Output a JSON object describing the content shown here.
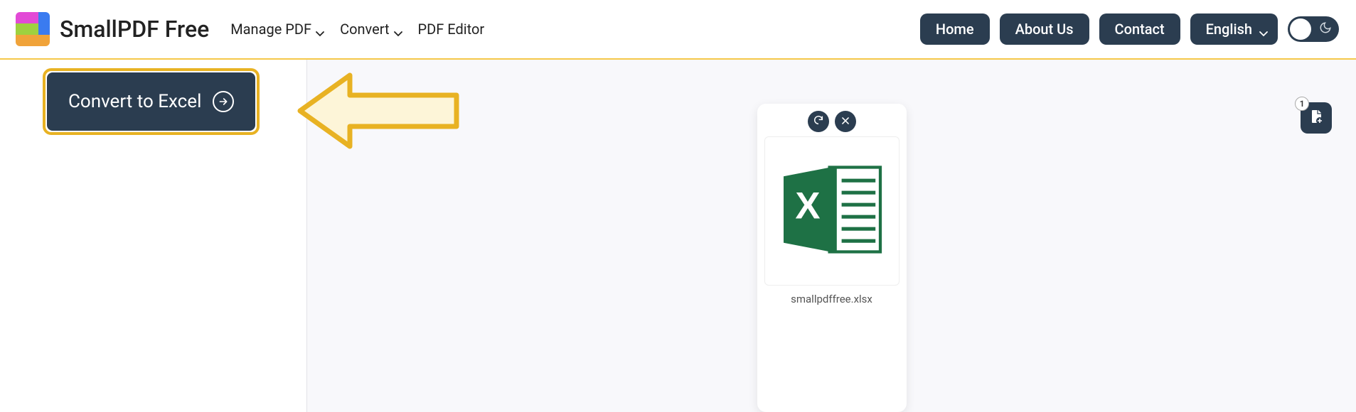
{
  "brand": "SmallPDF Free",
  "nav": {
    "manage_pdf": "Manage PDF",
    "convert": "Convert",
    "pdf_editor": "PDF Editor"
  },
  "header_buttons": {
    "home": "Home",
    "about": "About Us",
    "contact": "Contact",
    "language": "English"
  },
  "sidebar": {
    "convert_label": "Convert to Excel"
  },
  "file": {
    "name": "smallpdffree.xlsx"
  },
  "badge": {
    "count": "1"
  },
  "logo_colors": [
    "#e24ad6",
    "#e24ad6",
    "#3a7bf0",
    "#9ed13f",
    "#9ed13f",
    "#3a7bf0",
    "#f0a33a",
    "#f0a33a",
    "#f0a33a"
  ]
}
